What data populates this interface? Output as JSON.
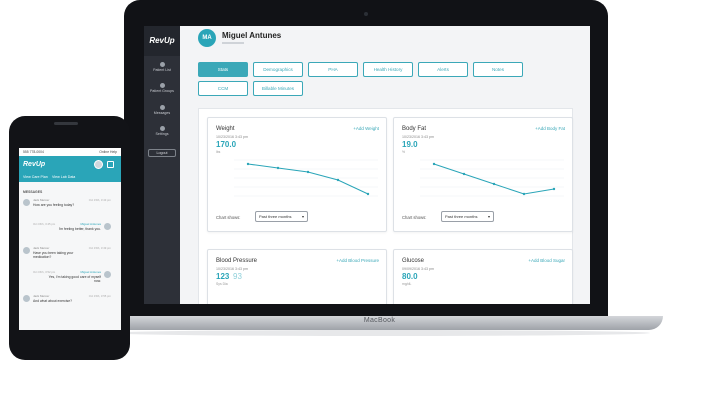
{
  "laptop": {
    "brand": "MacBook",
    "app": {
      "logo": "RevUp",
      "sidebar": {
        "items": [
          {
            "label": "Patient List",
            "icon": "users-icon"
          },
          {
            "label": "Patient Groups",
            "icon": "group-icon"
          },
          {
            "label": "Messages",
            "icon": "chat-icon"
          },
          {
            "label": "Settings",
            "icon": "gear-icon"
          }
        ],
        "logout_label": "Logout"
      },
      "patient": {
        "initials": "MA",
        "name": "Miguel Antunes"
      },
      "tabs": [
        {
          "label": "Stats",
          "active": true
        },
        {
          "label": "Demographics"
        },
        {
          "label": "PHA"
        },
        {
          "label": "Health History"
        },
        {
          "label": "Alerts"
        },
        {
          "label": "Notes"
        },
        {
          "label": "CCM"
        },
        {
          "label": "Billable Minutes"
        }
      ],
      "cards": [
        {
          "title": "Weight",
          "add_label": "+Add Weight",
          "date": "10/23/2016 3:43 pm",
          "value": "170.0",
          "unit": "lbs",
          "chart_label": "Chart shows:",
          "range": "Past three months",
          "trend": [
            180,
            178,
            176,
            172,
            165
          ]
        },
        {
          "title": "Body Fat",
          "add_label": "+Add Body Fat",
          "date": "10/23/2016 3:43 pm",
          "value": "19.0",
          "unit": "%",
          "chart_label": "Chart shows:",
          "range": "Past three months",
          "trend": [
            20,
            19.6,
            19.2,
            18.8,
            19.0
          ]
        },
        {
          "title": "Blood Pressure",
          "add_label": "+Add Blood Pressure",
          "date": "10/23/2016 3:43 pm",
          "value": "123",
          "value2": "93",
          "unit": "Sys    Dia"
        },
        {
          "title": "Glucose",
          "add_label": "+Add Blood Sugar",
          "date": "09/09/2016 3:43 pm",
          "value": "80.0",
          "unit": "mg/dL"
        }
      ],
      "accent_color": "#2aa5b8",
      "sidebar_color": "#2d3038"
    }
  },
  "phone": {
    "status": {
      "left": "555 778-0004",
      "right": "Online Help"
    },
    "logo": "RevUp",
    "links": [
      "View Care Plan",
      "View Lab Data"
    ],
    "section_title": "MESSAGES",
    "messages": [
      {
        "dir": "in",
        "sender": "Jack Mercer",
        "time": "Oct 15th, 3:43 pm",
        "text": "How are you feeling today?"
      },
      {
        "dir": "out",
        "sender": "Miguel Antunes",
        "time": "Oct 15th, 3:45 pm",
        "text": "I'm feeling better, thank you."
      },
      {
        "dir": "in",
        "sender": "Jack Mercer",
        "time": "Oct 15th, 3:49 pm",
        "text": "Have you been taking your medication?"
      },
      {
        "dir": "out",
        "sender": "Miguel Antunes",
        "time": "Oct 15th, 3:52 pm",
        "text": "Yes, I'm taking good care of myself now."
      },
      {
        "dir": "in",
        "sender": "Jack Mercer",
        "time": "Oct 15th, 3:55 pm",
        "text": "And what about exercise?"
      }
    ]
  }
}
